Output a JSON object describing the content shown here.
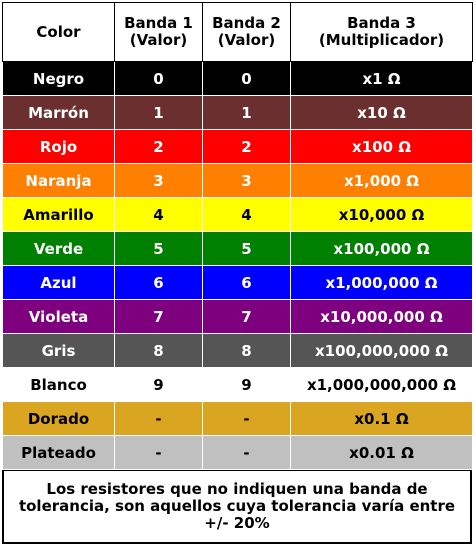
{
  "header": {
    "color": "Color",
    "band1": "Banda 1 (Valor)",
    "band2": "Banda 2 (Valor)",
    "band3": "Banda 3 (Multiplicador)"
  },
  "rows": [
    {
      "name": "Negro",
      "b1": "0",
      "b2": "0",
      "mult": "x1 Ω",
      "bg": "#000000",
      "dark": false
    },
    {
      "name": "Marrón",
      "b1": "1",
      "b2": "1",
      "mult": "x10 Ω",
      "bg": "#6b2f2f",
      "dark": false
    },
    {
      "name": "Rojo",
      "b1": "2",
      "b2": "2",
      "mult": "x100 Ω",
      "bg": "#ff0000",
      "dark": false
    },
    {
      "name": "Naranja",
      "b1": "3",
      "b2": "3",
      "mult": "x1,000 Ω",
      "bg": "#ff7f00",
      "dark": false
    },
    {
      "name": "Amarillo",
      "b1": "4",
      "b2": "4",
      "mult": "x10,000 Ω",
      "bg": "#ffff00",
      "dark": true
    },
    {
      "name": "Verde",
      "b1": "5",
      "b2": "5",
      "mult": "x100,000 Ω",
      "bg": "#008000",
      "dark": false
    },
    {
      "name": "Azul",
      "b1": "6",
      "b2": "6",
      "mult": "x1,000,000 Ω",
      "bg": "#0000ff",
      "dark": false
    },
    {
      "name": "Violeta",
      "b1": "7",
      "b2": "7",
      "mult": "x10,000,000 Ω",
      "bg": "#7f007f",
      "dark": false
    },
    {
      "name": "Gris",
      "b1": "8",
      "b2": "8",
      "mult": "x100,000,000 Ω",
      "bg": "#555555",
      "dark": false
    },
    {
      "name": "Blanco",
      "b1": "9",
      "b2": "9",
      "mult": "x1,000,000,000 Ω",
      "bg": "#ffffff",
      "dark": true
    },
    {
      "name": "Dorado",
      "b1": "-",
      "b2": "-",
      "mult": "x0.1 Ω",
      "bg": "#daa520",
      "dark": true
    },
    {
      "name": "Plateado",
      "b1": "-",
      "b2": "-",
      "mult": "x0.01 Ω",
      "bg": "#c0c0c0",
      "dark": true
    }
  ],
  "note": "Los resistores que no indiquen una banda de tolerancia, son aquellos cuya tolerancia varía entre +/- 20%"
}
